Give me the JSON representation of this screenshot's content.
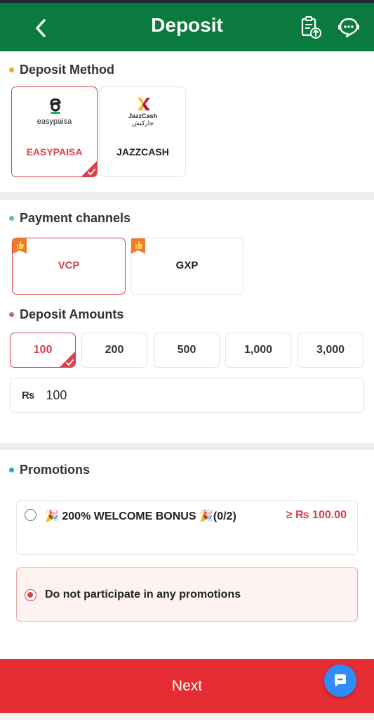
{
  "header": {
    "title": "Deposit",
    "back_icon": "chevron-left-icon",
    "records_icon": "clipboard-upload-icon",
    "support_icon": "chat-support-icon",
    "bg_color": "#0b7a3f"
  },
  "deposit_method": {
    "title": "Deposit Method",
    "dot_color": "#f2a623",
    "methods": [
      {
        "name": "EASYPAISA",
        "logo_text": "easypaisa",
        "selected": true
      },
      {
        "name": "JAZZCASH",
        "logo_text": "JazzCash",
        "logo_text_urdu": "جازکیش",
        "selected": false
      }
    ]
  },
  "payment_channels": {
    "title": "Payment channels",
    "dot_color": "#5bbfbd",
    "channels": [
      {
        "name": "VCP",
        "selected": true,
        "badge_icon": "thumb-up-badge-icon"
      },
      {
        "name": "GXP",
        "selected": false,
        "badge_icon": "thumb-up-badge-icon"
      }
    ]
  },
  "deposit_amounts": {
    "title": "Deposit Amounts",
    "dot_color": "#b56a86",
    "options": [
      "100",
      "200",
      "500",
      "1,000",
      "3,000"
    ],
    "selected_index": 0,
    "currency_symbol": "₨",
    "input_value": "100"
  },
  "promotions": {
    "title": "Promotions",
    "dot_color": "#2ba3dc",
    "items": [
      {
        "text": "🎉 200% WELCOME BONUS 🎉(0/2)",
        "min_amount": "≥ ₨ 100.00",
        "selected": false
      },
      {
        "text": "Do not participate in any promotions",
        "selected": true
      }
    ]
  },
  "footer": {
    "next_label": "Next",
    "next_color": "#e62d33",
    "chat_icon": "chat-bubble-icon"
  },
  "accent_color": "#d8434b"
}
